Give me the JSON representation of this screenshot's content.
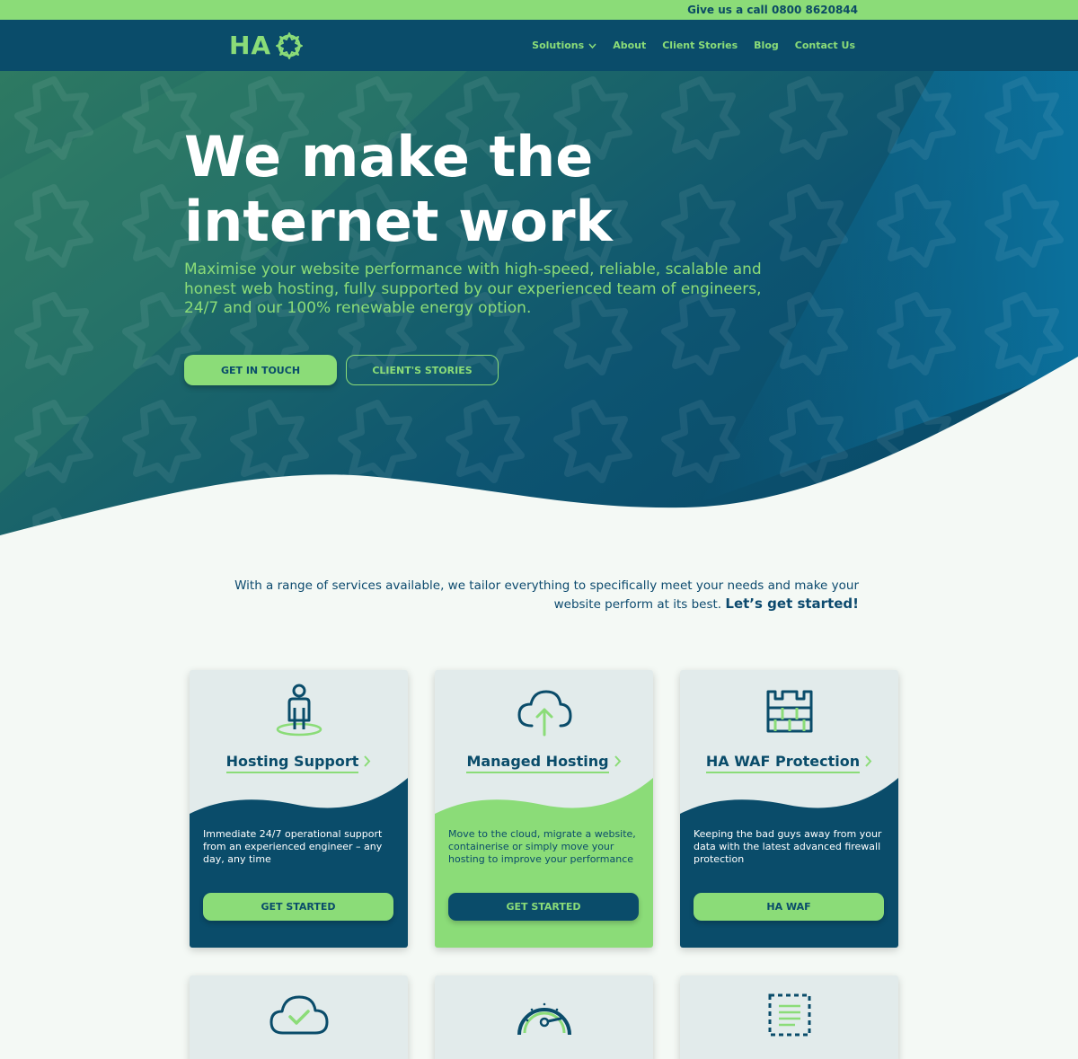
{
  "topbar": {
    "call_text": "Give us a call 0800 8620844"
  },
  "nav": {
    "logo_text": "HA",
    "items": [
      {
        "label": "Solutions",
        "has_dropdown": true
      },
      {
        "label": "About"
      },
      {
        "label": "Client Stories"
      },
      {
        "label": "Blog"
      },
      {
        "label": "Contact Us"
      }
    ]
  },
  "hero": {
    "headline_line1": "We make the",
    "headline_line2": "internet work",
    "subtext": "Maximise your website performance with high-speed, reliable, scalable and honest web hosting, fully supported by our experienced team of engineers, 24/7 and our 100% renewable energy option.",
    "primary_button": "GET IN TOUCH",
    "secondary_button": "CLIENT'S STORIES"
  },
  "intro": {
    "text": "With a range of services available, we tailor everything to specifically meet your needs and make your website perform at its best.",
    "emphasis": "Let’s get started!"
  },
  "cards": [
    {
      "icon": "person-icon",
      "title": "Hosting Support",
      "description": "Immediate 24/7 operational support from an experienced engineer – any day, any time",
      "button": "GET STARTED",
      "theme": "dark"
    },
    {
      "icon": "cloud-upload-icon",
      "title": "Managed Hosting",
      "description": "Move to the cloud, migrate a website, containerise or simply move your hosting to improve your performance",
      "button": "GET STARTED",
      "theme": "light"
    },
    {
      "icon": "firewall-icon",
      "title": "HA WAF Protection",
      "description": "Keeping the bad guys away from your data with the latest advanced firewall protection",
      "button": "HA WAF",
      "theme": "dark"
    }
  ],
  "lower_cards": [
    {
      "icon": "cloud-check-icon"
    },
    {
      "icon": "speedometer-icon"
    },
    {
      "icon": "document-icon"
    }
  ],
  "colors": {
    "brand_navy": "#0a4c6a",
    "brand_green": "#8bdc78",
    "card_bg": "#e2ebeb",
    "page_bg": "#f4f9f5"
  }
}
